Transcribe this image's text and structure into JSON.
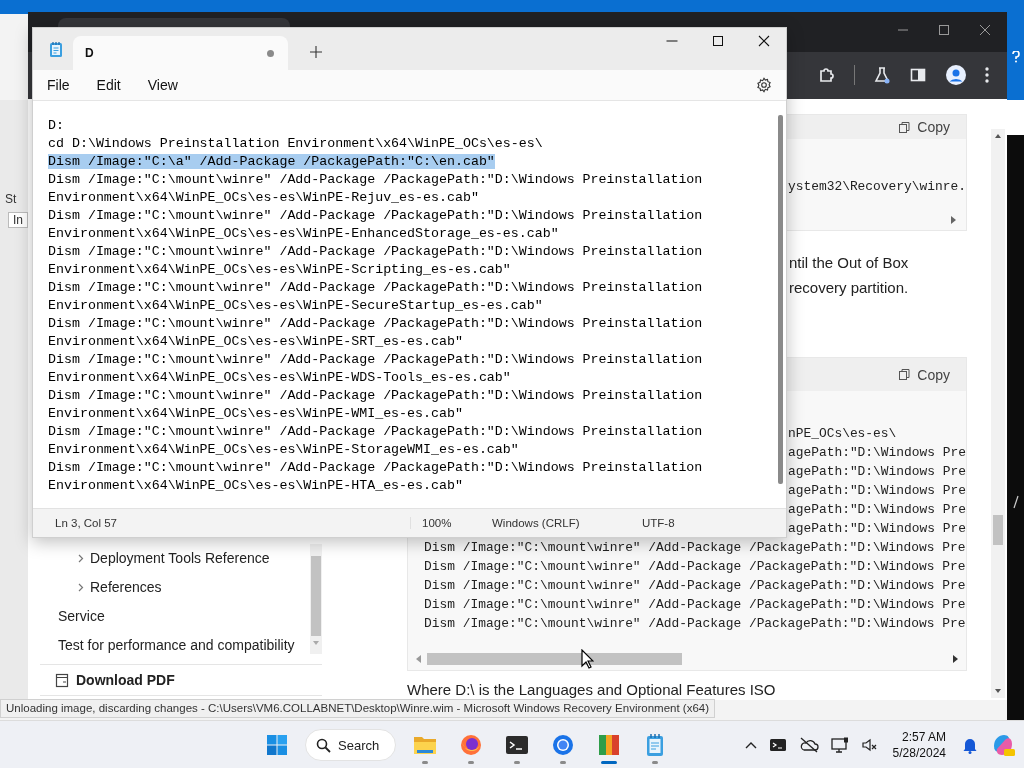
{
  "desktop": {
    "left_texts": [
      "St",
      "In"
    ]
  },
  "browser": {
    "nav": [
      {
        "label": "Deployment Tools Reference",
        "kind": "expandable"
      },
      {
        "label": "References",
        "kind": "expandable"
      },
      {
        "label": "Service",
        "kind": "link"
      },
      {
        "label": "Test for performance and compatibility",
        "kind": "link"
      }
    ],
    "download": "Download PDF",
    "code_block_1": {
      "copy": "Copy",
      "lines": [
        {
          "text": "ystem32\\Recovery\\winre.",
          "kind": "fragment"
        }
      ]
    },
    "paragraph_fragments": [
      "ntil the Out of Box",
      "recovery partition."
    ],
    "code_block_2": {
      "copy": "Copy",
      "lines": [
        {
          "text": "nPE_OCs\\es-es\\",
          "kind": "fragment"
        },
        {
          "text": "agePath:\"D:\\Windows Pre",
          "kind": "fragment"
        },
        {
          "text": "agePath:\"D:\\Windows Pre",
          "kind": "fragment"
        },
        {
          "text": "agePath:\"D:\\Windows Pre",
          "kind": "fragment"
        },
        {
          "text": "agePath:\"D:\\Windows Pre",
          "kind": "fragment"
        },
        {
          "text": "agePath:\"D:\\Windows Pre",
          "kind": "fragment"
        },
        {
          "text": "Dism /Image:\"C:\\mount\\winre\" /Add-Package /PackagePath:\"D:\\Windows Pre",
          "kind": "full"
        },
        {
          "text": "Dism /Image:\"C:\\mount\\winre\" /Add-Package /PackagePath:\"D:\\Windows Pre",
          "kind": "full"
        },
        {
          "text": "Dism /Image:\"C:\\mount\\winre\" /Add-Package /PackagePath:\"D:\\Windows Pre",
          "kind": "full"
        },
        {
          "text": "Dism /Image:\"C:\\mount\\winre\" /Add-Package /PackagePath:\"D:\\Windows Pre",
          "kind": "full"
        },
        {
          "text": "Dism /Image:\"C:\\mount\\winre\" /Add-Package /PackagePath:\"D:\\Windows Pre",
          "kind": "full"
        }
      ]
    },
    "footer_text": "Where D:\\ is the Languages and Optional Features ISO"
  },
  "notepad": {
    "tab": {
      "title": "D",
      "unsaved": true
    },
    "menu": [
      "File",
      "Edit",
      "View"
    ],
    "lines": [
      {
        "text": "D:",
        "selected": false
      },
      {
        "text": "cd D:\\Windows Preinstallation Environment\\x64\\WinPE_OCs\\es-es\\",
        "selected": false
      },
      {
        "text": "Dism /Image:\"C:\\a\" /Add-Package /PackagePath:\"C:\\en.cab\"",
        "selected": true
      },
      {
        "text": "Dism /Image:\"C:\\mount\\winre\" /Add-Package /PackagePath:\"D:\\Windows Preinstallation Environment\\x64\\WinPE_OCs\\es-es\\WinPE-Rejuv_es-es.cab\"",
        "selected": false
      },
      {
        "text": "Dism /Image:\"C:\\mount\\winre\" /Add-Package /PackagePath:\"D:\\Windows Preinstallation Environment\\x64\\WinPE_OCs\\es-es\\WinPE-EnhancedStorage_es-es.cab\"",
        "selected": false
      },
      {
        "text": "Dism /Image:\"C:\\mount\\winre\" /Add-Package /PackagePath:\"D:\\Windows Preinstallation Environment\\x64\\WinPE_OCs\\es-es\\WinPE-Scripting_es-es.cab\"",
        "selected": false
      },
      {
        "text": "Dism /Image:\"C:\\mount\\winre\" /Add-Package /PackagePath:\"D:\\Windows Preinstallation Environment\\x64\\WinPE_OCs\\es-es\\WinPE-SecureStartup_es-es.cab\"",
        "selected": false
      },
      {
        "text": "Dism /Image:\"C:\\mount\\winre\" /Add-Package /PackagePath:\"D:\\Windows Preinstallation Environment\\x64\\WinPE_OCs\\es-es\\WinPE-SRT_es-es.cab\"",
        "selected": false
      },
      {
        "text": "Dism /Image:\"C:\\mount\\winre\" /Add-Package /PackagePath:\"D:\\Windows Preinstallation Environment\\x64\\WinPE_OCs\\es-es\\WinPE-WDS-Tools_es-es.cab\"",
        "selected": false
      },
      {
        "text": "Dism /Image:\"C:\\mount\\winre\" /Add-Package /PackagePath:\"D:\\Windows Preinstallation Environment\\x64\\WinPE_OCs\\es-es\\WinPE-WMI_es-es.cab\"",
        "selected": false
      },
      {
        "text": "Dism /Image:\"C:\\mount\\winre\" /Add-Package /PackagePath:\"D:\\Windows Preinstallation Environment\\x64\\WinPE_OCs\\es-es\\WinPE-StorageWMI_es-es.cab\"",
        "selected": false
      },
      {
        "text": "Dism /Image:\"C:\\mount\\winre\" /Add-Package /PackagePath:\"D:\\Windows Preinstallation Environment\\x64\\WinPE_OCs\\es-es\\WinPE-HTA_es-es.cab\"",
        "selected": false
      }
    ],
    "status": {
      "position": "Ln 3, Col 57",
      "zoom": "100%",
      "line_endings": "Windows (CRLF)",
      "encoding": "UTF-8"
    }
  },
  "status_tooltip": "Unloading image, discarding changes - C:\\Users\\VM6.COLLABNET\\Desktop\\Winre.wim - Microsoft Windows Recovery Environment (x64)",
  "taskbar": {
    "search": "Search",
    "apps": [
      {
        "kind": "explorer",
        "active": false
      },
      {
        "kind": "firefox",
        "active": false
      },
      {
        "kind": "terminal",
        "active": false
      },
      {
        "kind": "chrome",
        "active": false
      },
      {
        "kind": "office",
        "active": true
      },
      {
        "kind": "notepad",
        "active": false
      }
    ],
    "time": "2:57 AM",
    "date": "5/28/2024"
  }
}
